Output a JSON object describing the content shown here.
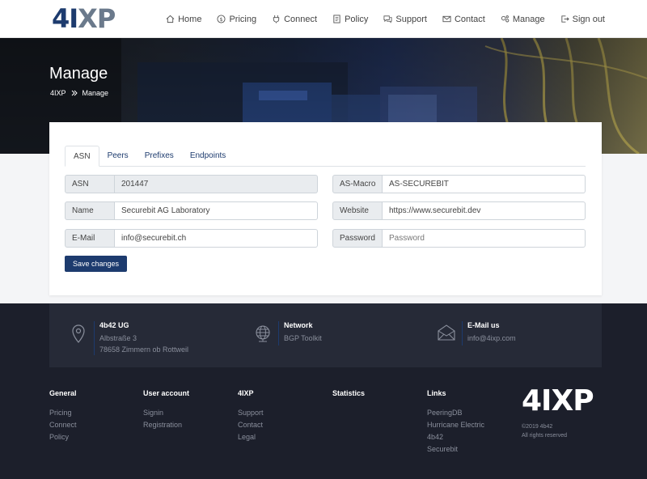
{
  "header": {
    "logo_part1": "4I",
    "logo_part2": "XP",
    "nav": [
      {
        "label": "Home",
        "icon": "home-icon"
      },
      {
        "label": "Pricing",
        "icon": "dollar-icon"
      },
      {
        "label": "Connect",
        "icon": "plug-icon"
      },
      {
        "label": "Policy",
        "icon": "document-icon"
      },
      {
        "label": "Support",
        "icon": "chat-icon"
      },
      {
        "label": "Contact",
        "icon": "mail-icon"
      },
      {
        "label": "Manage",
        "icon": "gears-icon"
      },
      {
        "label": "Sign out",
        "icon": "sign-out-icon"
      }
    ]
  },
  "hero": {
    "title": "Manage",
    "breadcrumb_root": "4IXP",
    "breadcrumb_current": "Manage"
  },
  "tabs": [
    "ASN",
    "Peers",
    "Prefixes",
    "Endpoints"
  ],
  "form": {
    "asn_label": "ASN",
    "asn_value": "201447",
    "name_label": "Name",
    "name_value": "Securebit AG Laboratory",
    "email_label": "E-Mail",
    "email_value": "info@securebit.ch",
    "asmacro_label": "AS-Macro",
    "asmacro_value": "AS-SECUREBIT",
    "website_label": "Website",
    "website_value": "https://www.securebit.dev",
    "password_label": "Password",
    "password_placeholder": "Password",
    "save_label": "Save changes"
  },
  "footer": {
    "address_title": "4b42 UG",
    "address_line1": "Albstraße 3",
    "address_line2": "78658 Zimmern ob Rottweil",
    "network_title": "Network",
    "network_link": "BGP Toolkit",
    "email_title": "E-Mail us",
    "email_link": "info@4ixp.com",
    "columns": [
      {
        "heading": "General",
        "links": [
          "Pricing",
          "Connect",
          "Policy"
        ]
      },
      {
        "heading": "User account",
        "links": [
          "Signin",
          "Registration"
        ]
      },
      {
        "heading": "4IXP",
        "links": [
          "Support",
          "Contact",
          "Legal"
        ]
      },
      {
        "heading": "Statistics",
        "links": []
      },
      {
        "heading": "Links",
        "links": [
          "PeeringDB",
          "Hurricane Electric",
          "4b42",
          "Securebit"
        ]
      }
    ],
    "logo_text": "4IXP",
    "copyright": "©2019 4b42",
    "rights": "All rights reserved"
  },
  "colors": {
    "primary": "#1d3b6e",
    "footer_bg": "#1c1f2b",
    "contact_bar_bg": "#262a37"
  }
}
